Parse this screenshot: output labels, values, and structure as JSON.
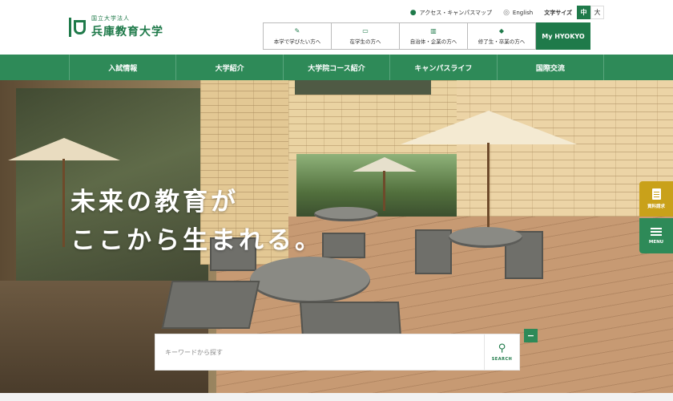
{
  "header": {
    "logo": {
      "subtitle": "国立大学法人",
      "name": "兵庫教育大学"
    },
    "utility": {
      "access_label": "アクセス・キャンパスマップ",
      "english_label": "English",
      "font_size_label": "文字サイズ",
      "font_size_options": [
        "中",
        "大"
      ],
      "font_size_selected": "中"
    },
    "audience_buttons": [
      {
        "label": "本学で学びたい方へ",
        "icon": "pencil-icon"
      },
      {
        "label": "在学生の方へ",
        "icon": "book-icon"
      },
      {
        "label": "自治体・企業の方へ",
        "icon": "building-icon"
      },
      {
        "label": "修了生・卒業の方へ",
        "icon": "graduation-cap-icon"
      }
    ],
    "my_button_label": "My HYOKYO"
  },
  "nav": {
    "items": [
      "入試情報",
      "大学紹介",
      "大学院コース紹介",
      "キャンパスライフ",
      "国際交流"
    ]
  },
  "hero": {
    "tagline_line1": "未来の教育が",
    "tagline_line2": "ここから生まれる。",
    "search": {
      "placeholder": "キーワードから探す",
      "button_label": "SEARCH"
    },
    "collapse_symbol": "−"
  },
  "side_tabs": {
    "document_request_label": "資料請求",
    "menu_label": "MENU"
  },
  "colors": {
    "brand_green": "#1f7a4a",
    "nav_green": "#2e8a58",
    "accent_gold": "#c9a11a"
  }
}
